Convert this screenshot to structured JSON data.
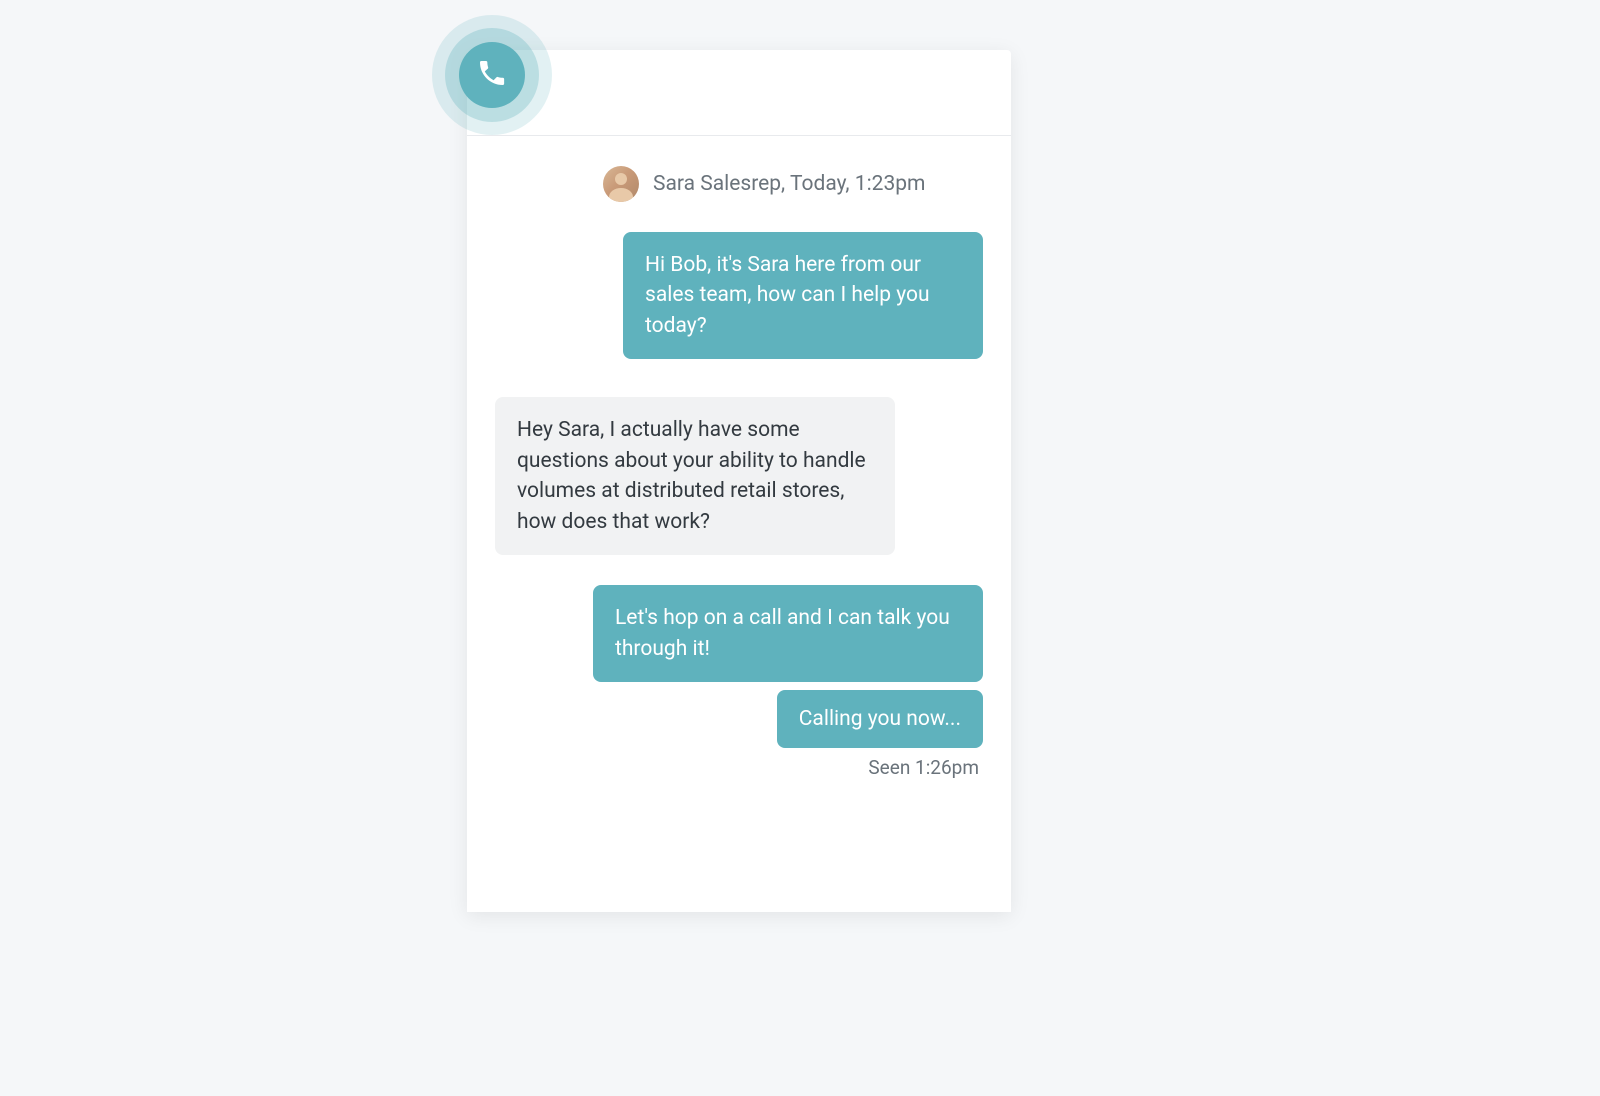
{
  "colors": {
    "accent": "#5fb2bd",
    "received_bg": "#f1f2f3",
    "text_muted": "#6a737b",
    "text_body": "#333a40",
    "page_bg": "#f5f7f9"
  },
  "icons": {
    "phone": "phone-icon"
  },
  "sender": {
    "name": "Sara Salesrep",
    "timestamp": "Today, 1:23pm",
    "header_line": "Sara Salesrep, Today, 1:23pm"
  },
  "messages": [
    {
      "side": "sent",
      "text": "Hi Bob, it's Sara here from our sales team, how can I help you today?"
    },
    {
      "side": "received",
      "text": "Hey Sara, I actually have some questions about your ability to handle volumes at distributed retail stores, how does that work?"
    },
    {
      "side": "sent",
      "text": "Let's hop on a call and I can talk you through it!"
    },
    {
      "side": "sent",
      "text": "Calling you now..."
    }
  ],
  "seen": {
    "label": "Seen 1:26pm"
  }
}
